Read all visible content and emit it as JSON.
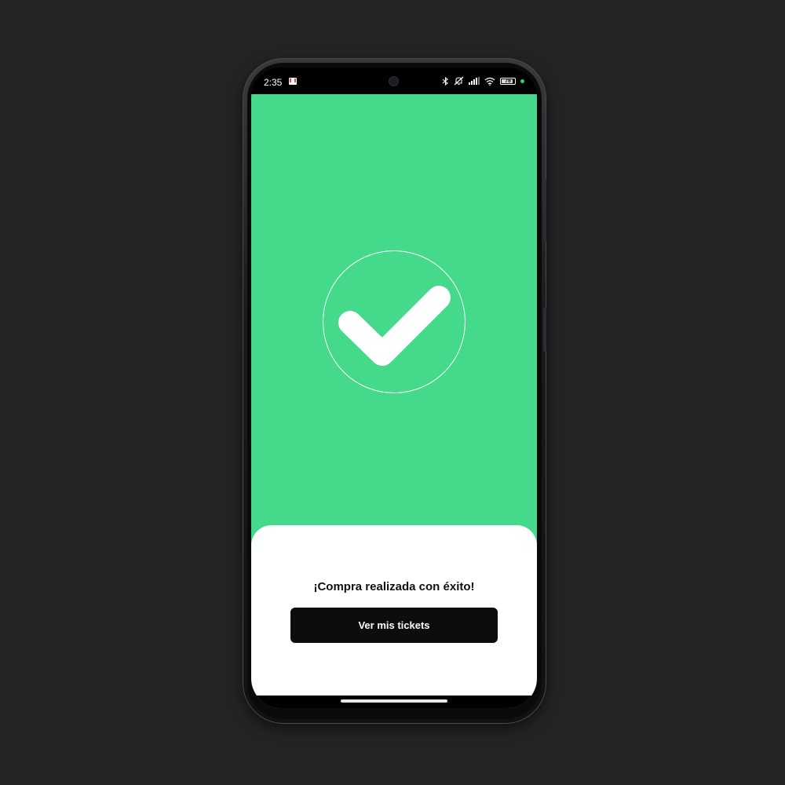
{
  "status_bar": {
    "time": "2:35",
    "battery_level": "78",
    "icons": [
      "gmail-icon",
      "bluetooth-icon",
      "mute-icon",
      "signal-icon",
      "wifi-icon",
      "battery-icon",
      "privacy-dot"
    ]
  },
  "success": {
    "icon": "check-icon",
    "title": "¡Compra realizada con éxito!",
    "button_label": "Ver mis tickets"
  },
  "colors": {
    "accent_green": "#45da8b",
    "button_bg": "#0d0c0e",
    "sheet_bg": "#ffffff"
  }
}
